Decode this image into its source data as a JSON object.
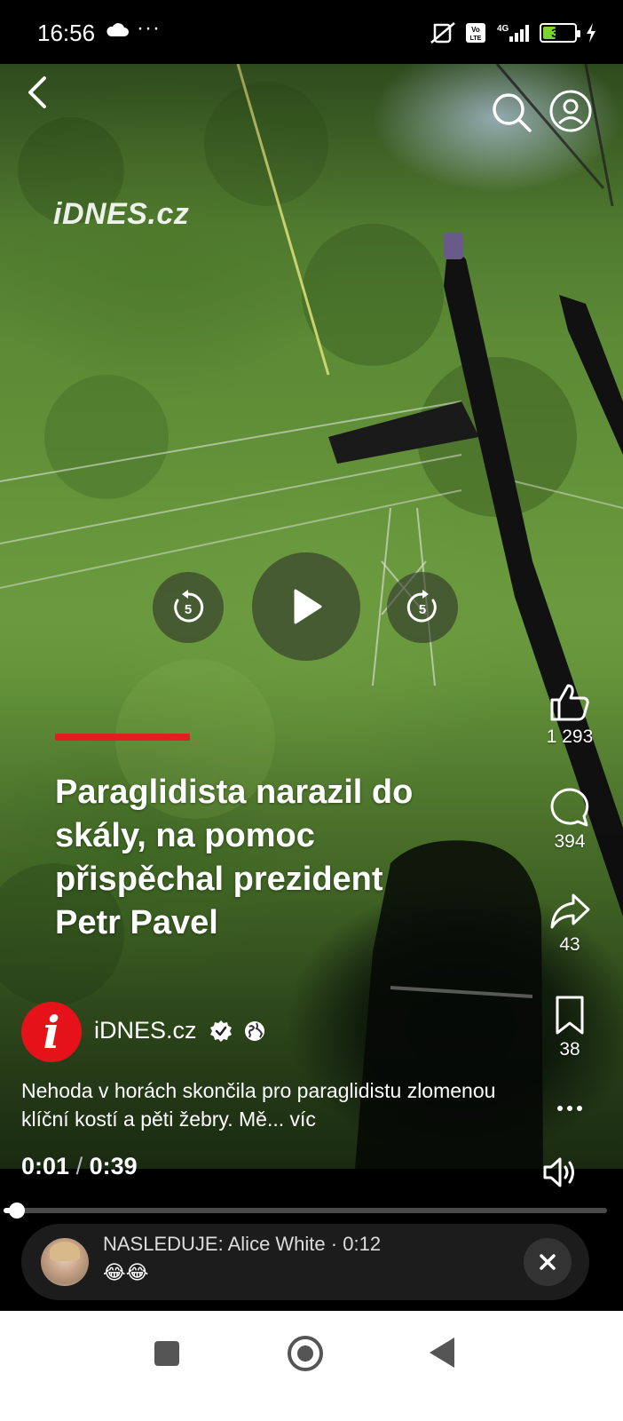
{
  "status_bar": {
    "time": "16:56",
    "dots": "···",
    "network": "4G",
    "volte": "Vo LTE",
    "battery": "34"
  },
  "video": {
    "watermark": "iDNES.cz",
    "headline": "Paraglidista narazil do skály, na pomoc přispěchal prezident Petr Pavel",
    "rewind_seconds": "5",
    "forward_seconds": "5"
  },
  "actions": {
    "likes": "1 293",
    "comments": "394",
    "shares": "43",
    "saves": "38"
  },
  "author": {
    "logo_letter": "i",
    "name": "iDNES.cz"
  },
  "description": {
    "text": "Nehoda v horách skončila pro paraglidistu zlomenou klíční kostí a pěti žebry. Mě...",
    "more": "víc"
  },
  "player": {
    "current_time": "0:01",
    "separator": "/",
    "duration": "0:39",
    "progress_fraction": 0.025
  },
  "next_up": {
    "label": "NASLEDUJE:",
    "name": "Alice White",
    "dot": "·",
    "time": "0:12",
    "emoji": "😂😂"
  },
  "colors": {
    "accent_red": "#e02020",
    "logo_red": "#e5121a",
    "battery_green": "#7cd432"
  }
}
